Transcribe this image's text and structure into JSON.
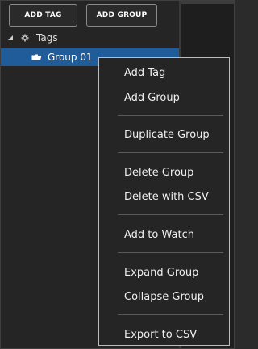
{
  "toolbar": {
    "add_tag_label": "ADD TAG",
    "add_group_label": "ADD GROUP"
  },
  "tree": {
    "root": {
      "label": "Tags",
      "expanded": true,
      "expander_icon": "triangle-expanded-icon",
      "icon": "gear-icon"
    },
    "children": [
      {
        "label": "Group 01",
        "icon": "folder-icon",
        "selected": true
      }
    ]
  },
  "context_menu": {
    "items": [
      {
        "label": "Add Tag"
      },
      {
        "label": "Add Group"
      },
      {
        "label": "Duplicate Group"
      },
      {
        "label": "Delete Group"
      },
      {
        "label": "Delete with CSV"
      },
      {
        "label": "Add to Watch"
      },
      {
        "label": "Expand Group"
      },
      {
        "label": "Collapse Group"
      },
      {
        "label": "Export to CSV"
      }
    ]
  },
  "colors": {
    "selection": "#1f5c99",
    "panel_bg": "#252526",
    "menu_border": "#bdbdbd",
    "text": "#f0f0f0"
  }
}
